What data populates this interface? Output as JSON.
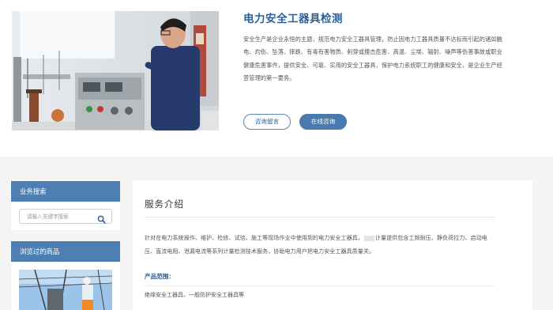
{
  "product": {
    "title": "电力安全工器具检测",
    "description": "安全生产是企业永恒的主题，规范电力安全工器具管理，防止因电力工器具质量不达标而引起的诸如触电、灼伤、坠落、摔跌、有毒有害物质、刺穿或撞击危害、高温、尘埃、辐射、噪声等伤害事故或职业健康危害事件，提供安全、可靠、实用的安全工器具，保护电力系统职工的健康和安全，是企业生产经营管理的第一要务。",
    "consult_button": "咨询留言",
    "online_button": "在线咨询"
  },
  "sidebar": {
    "search_title": "业务搜索",
    "search_placeholder": "请输入关键字搜索",
    "browsed_title": "浏览过的商品"
  },
  "content": {
    "section_title": "服务介绍",
    "intro_part1": "针对在电力系统操作、维护、检修、试验、施工等现场作业中使用到的电力安全工器具，",
    "intro_part2": "计量提供包含工频耐压、静负荷拉力、启动电压、直流电阻、泄漏电流等系列计量检测技术服务，协助电力用户把电力安全工器具质量关。",
    "scope_title": "产品范围：",
    "scope_text": "绝缘安全工器具、一般防护安全工器具等"
  },
  "colors": {
    "accent": "#2d5f96",
    "sidebar_header": "#4e7fb3",
    "button_fill": "#4a79ad",
    "lower_background": "#f4f4f4"
  },
  "icons": [
    "search-icon"
  ]
}
